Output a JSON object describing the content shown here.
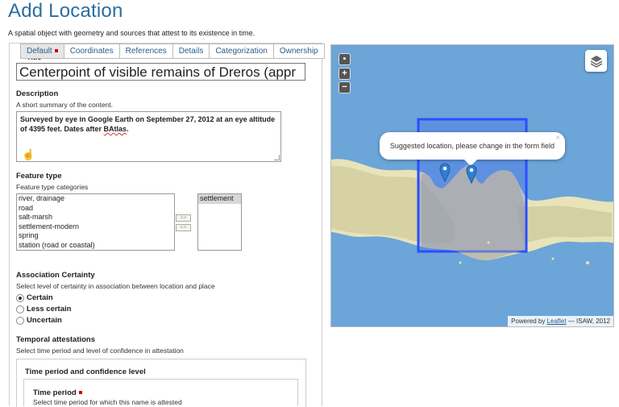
{
  "header": {
    "title": "Add Location",
    "description": "A spatial object with geometry and sources that attest to its existence in time."
  },
  "tabs": [
    {
      "label": "Default"
    },
    {
      "label": "Coordinates"
    },
    {
      "label": "References"
    },
    {
      "label": "Details"
    },
    {
      "label": "Categorization"
    },
    {
      "label": "Ownership"
    }
  ],
  "form": {
    "title_label": "Title",
    "title_value": "Centerpoint of visible remains of Dreros (appr",
    "description_label": "Description",
    "description_help": "A short summary of the content.",
    "description_value_part1": "Surveyed by eye in Google Earth on September 27, 2012 at an eye altitude of 4395 feet. Dates after ",
    "description_value_misspelled": "BAtlas",
    "description_value_part2": ".",
    "feature_type_label": "Feature type",
    "feature_type_help": "Feature type categories",
    "feature_options": [
      "river, drainage",
      "road",
      "salt-marsh",
      "settlement-modern",
      "spring",
      "station (road or coastal)"
    ],
    "feature_selected": [
      "settlement"
    ],
    "add_button": ">>",
    "remove_button": "<<",
    "certainty_label": "Association Certainty",
    "certainty_help": "Select level of certainty in association between location and place",
    "certainty_options": [
      "Certain",
      "Less certain",
      "Uncertain"
    ],
    "certainty_selected": "Certain",
    "temporal_label": "Temporal attestations",
    "temporal_help": "Select time period and level of confidence in attestation",
    "period_panel_title": "Time period and confidence level",
    "time_period_label": "Time period",
    "time_period_help": "Select time period for which this name is attested"
  },
  "map": {
    "zoom_in": "+",
    "zoom_out": "−",
    "popup_text": "Suggested location, please change in the form field",
    "popup_close": "×",
    "attribution_prefix": "Powered by ",
    "attribution_link": "Leaflet",
    "attribution_suffix": " — ISAW, 2012",
    "sea_color": "#6ca5d8",
    "box_color": "#2a4fff"
  }
}
